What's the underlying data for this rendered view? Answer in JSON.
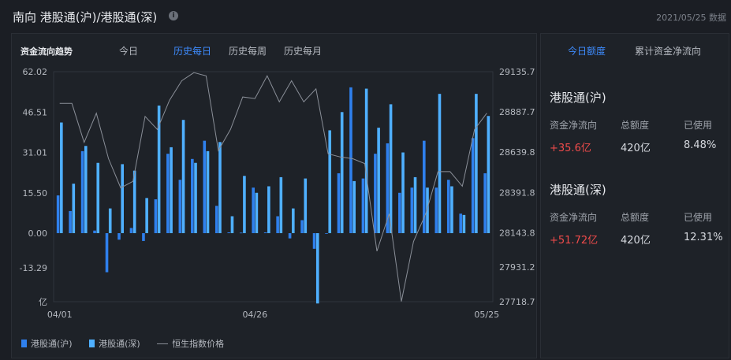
{
  "header": {
    "title": "南向 港股通(沪)/港股通(深)",
    "info_icon": "info-circle-icon",
    "date_note": "2021/05/25 数据"
  },
  "chart_panel": {
    "label": "资金流向趋势",
    "tabs": [
      {
        "label": "今日",
        "active": false
      },
      {
        "label": "历史每日",
        "active": true
      },
      {
        "label": "历史每周",
        "active": false
      },
      {
        "label": "历史每月",
        "active": false
      }
    ]
  },
  "colors": {
    "hu": "#2f80ed",
    "shen": "#4fb0ff",
    "hsi_line": "#8a8f98",
    "accent": "#3e8cff",
    "positive": "#f04b4b"
  },
  "chart_data": {
    "type": "bar",
    "y_left_ticks": [
      "62.02",
      "46.51",
      "31.01",
      "15.50",
      "0.00",
      "-13.29",
      "亿"
    ],
    "y_left_range": [
      -27.02,
      62.02
    ],
    "y_right_ticks": [
      "29135.7",
      "28887.7",
      "28639.8",
      "28391.8",
      "28143.8",
      "27931.2",
      "27718.7"
    ],
    "y_right_range": [
      27718.7,
      29135.7
    ],
    "x_tick_labels": [
      {
        "index": 0,
        "label": "04/01"
      },
      {
        "index": 16,
        "label": "04/26"
      },
      {
        "index": 35,
        "label": "05/25"
      }
    ],
    "series": [
      {
        "name": "港股通(沪)",
        "axis": "left",
        "values": [
          14.5,
          8.5,
          31.5,
          1.0,
          -15.0,
          -2.5,
          2.0,
          -3.0,
          13.0,
          30.5,
          20.5,
          28.5,
          35.5,
          10.5,
          0.3,
          0.2,
          17.5,
          0.3,
          6.5,
          -2.0,
          5.0,
          -6.0,
          0.0,
          23.0,
          56.0,
          21.0,
          30.5,
          34.5,
          15.5,
          17.5,
          35.5,
          17.5,
          20.5,
          7.5,
          36.5,
          23.0
        ]
      },
      {
        "name": "港股通(深)",
        "axis": "left",
        "values": [
          42.5,
          19.0,
          33.5,
          27.0,
          9.5,
          26.5,
          24.0,
          13.5,
          49.0,
          33.0,
          43.5,
          27.0,
          31.5,
          35.0,
          6.5,
          22.0,
          15.5,
          18.0,
          21.5,
          9.5,
          21.0,
          -27.0,
          39.5,
          46.5,
          20.0,
          55.5,
          40.5,
          49.5,
          31.0,
          21.5,
          17.5,
          53.5,
          18.0,
          7.0,
          53.5,
          45.0
        ]
      },
      {
        "name": "恒生指数价格",
        "axis": "right",
        "type": "line",
        "values": [
          28940,
          28940,
          28700,
          28880,
          28600,
          28420,
          28460,
          28860,
          28780,
          28960,
          29080,
          29130,
          29110,
          28650,
          28780,
          28980,
          28970,
          29110,
          28950,
          29080,
          28950,
          29030,
          28630,
          28610,
          28600,
          28570,
          28030,
          28260,
          27720,
          28090,
          28260,
          28520,
          28520,
          28430,
          28780,
          28880
        ]
      }
    ]
  },
  "legend": [
    {
      "name": "港股通(沪)",
      "shape": "bar"
    },
    {
      "name": "港股通(深)",
      "shape": "bar"
    },
    {
      "name": "恒生指数价格",
      "shape": "line"
    }
  ],
  "right_panel": {
    "tabs": [
      {
        "label": "今日额度",
        "active": true
      },
      {
        "label": "累计资金净流向",
        "active": false
      }
    ],
    "blocks": [
      {
        "title": "港股通(沪)",
        "headers": [
          "资金净流向",
          "总额度",
          "已使用"
        ],
        "values": [
          "+35.6亿",
          "420亿",
          "8.48%"
        ]
      },
      {
        "title": "港股通(深)",
        "headers": [
          "资金净流向",
          "总额度",
          "已使用"
        ],
        "values": [
          "+51.72亿",
          "420亿",
          "12.31%"
        ]
      }
    ]
  }
}
